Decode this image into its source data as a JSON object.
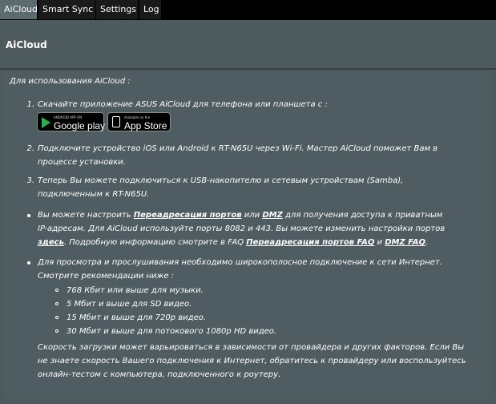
{
  "tabs": [
    {
      "label": "AiCloud"
    },
    {
      "label": "Smart Sync"
    },
    {
      "label": "Settings"
    },
    {
      "label": "Log"
    }
  ],
  "page": {
    "title": "AiCloud"
  },
  "content": {
    "intro": "Для использования AiCloud :",
    "steps": [
      {
        "num": "1.",
        "text": "Скачайте приложение ASUS AiCloud для телефона или планшета с :"
      },
      {
        "num": "2.",
        "line1": "Подключите устройство iOS или Android к RT-N65U через Wi-Fi. Мастер AiCloud поможет Вам в",
        "line2": "процессе установки."
      },
      {
        "num": "3.",
        "line1": "Теперь Вы можете подключиться к USB-накопителю и сетевым устройствам (Samba),",
        "line2": "подключенным к RT-N65U."
      }
    ],
    "badges": {
      "google_play": {
        "small": "ANDROID APP ON",
        "big": "Google play"
      },
      "app_store": {
        "small": "Available on the",
        "big": "App Store"
      }
    },
    "bullet1": {
      "l1_a": "Вы можете настроить ",
      "l1_link1": "Переадресация портов",
      "l1_b": " или ",
      "l1_link2": "DMZ",
      "l1_c": " для получения доступа к приватным",
      "l2": "IP-адресам.  Для AiCloud используйте порты 8082 и 443. Вы можете изменить настройки портов",
      "l3_link": "здесь",
      "l3_a": ".  Подробную информацию смотрите в FAQ ",
      "l3_link2": "Переадресация портов FAQ",
      "l3_b": " и ",
      "l3_link3": "DMZ FAQ",
      "l3_c": "."
    },
    "bullet2": {
      "l1": "Для просмотра и прослушивания необходимо широкополосное подключение к сети Интернет.",
      "l2": "Смотрите рекомендации ниже :",
      "subs": [
        "768 Кбит или выше для музыки.",
        "5 Мбит и выше для SD видео.",
        "15 Мбит и выше для 720p видео.",
        "30 Мбит и выше для потокового 1080p HD видео."
      ],
      "f1": "Скорость загрузки может варьироваться в зависимости от провайдера и других факторов. Если Вы",
      "f2": "не знаете скорость Вашего подключения к Интернет, обратитесь к провайдеру или воспользуйтесь",
      "f3": "онлайн-тестом с компьютера, подключенного к роутеру."
    }
  }
}
